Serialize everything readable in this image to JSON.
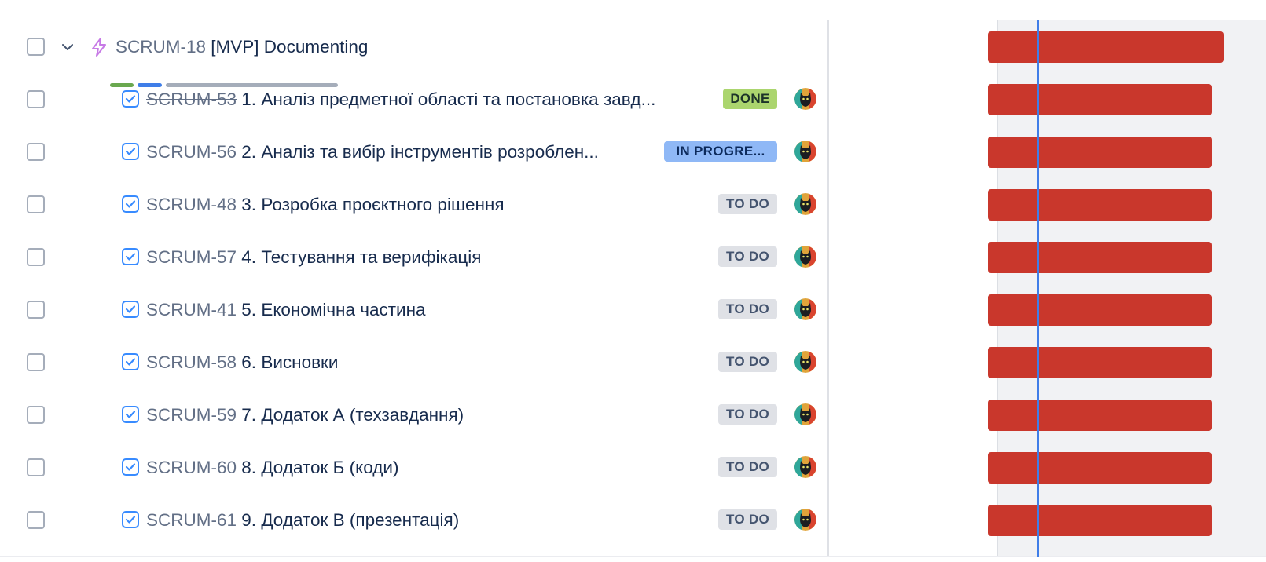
{
  "colors": {
    "bar": "#c9372c",
    "today_line": "#3f7ee8",
    "done_lozenge": "#abd56e",
    "in_progress_lozenge": "#8fb8f6",
    "todo_lozenge": "#dfe1e6",
    "epic_icon": "#c77ae6",
    "task_icon": "#388bff"
  },
  "epic": {
    "key": "SCRUM-18",
    "title": "[MVP] Documenting",
    "progress": {
      "done_fraction": 0.11,
      "in_progress_fraction": 0.11,
      "todo_fraction": 0.78
    }
  },
  "tasks": [
    {
      "key": "SCRUM-53",
      "title": "1. Аналіз предметної області та постановка завд...",
      "status": "DONE",
      "done": true
    },
    {
      "key": "SCRUM-56",
      "title": "2. Аналіз та вибір інструментів розроблен...",
      "status": "IN PROGRE...",
      "done": false
    },
    {
      "key": "SCRUM-48",
      "title": "3. Розробка проєктного рішення",
      "status": "TO DO",
      "done": false
    },
    {
      "key": "SCRUM-57",
      "title": "4. Тестування та верифікація",
      "status": "TO DO",
      "done": false
    },
    {
      "key": "SCRUM-41",
      "title": "5. Економічна частина",
      "status": "TO DO",
      "done": false
    },
    {
      "key": "SCRUM-58",
      "title": "6. Висновки",
      "status": "TO DO",
      "done": false
    },
    {
      "key": "SCRUM-59",
      "title": "7. Додаток А (техзавдання)",
      "status": "TO DO",
      "done": false
    },
    {
      "key": "SCRUM-60",
      "title": "8. Додаток Б (коди)",
      "status": "TO DO",
      "done": false
    },
    {
      "key": "SCRUM-61",
      "title": "9. Додаток В (презентація)",
      "status": "TO DO",
      "done": false
    }
  ]
}
